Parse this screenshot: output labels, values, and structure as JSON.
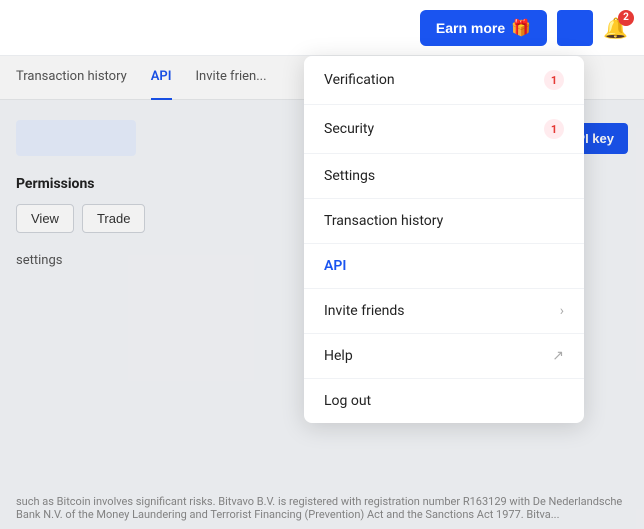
{
  "header": {
    "earn_more_label": "Earn more",
    "earn_more_icon": "🎁",
    "bell_badge": "2"
  },
  "tabs": [
    {
      "label": "Transaction history",
      "active": false
    },
    {
      "label": "API",
      "active": true
    },
    {
      "label": "Invite frien...",
      "active": false
    }
  ],
  "main": {
    "add_api_label": "+ API key",
    "permissions_label": "Permissions",
    "perm_view": "View",
    "perm_trade": "Trade",
    "settings_label": "settings"
  },
  "footer_text": "such as Bitcoin involves significant risks. Bitvavo B.V. is registered with registration number R163129 with De Nederlandsche Bank N.V. of the Money Laundering and Terrorist Financing (Prevention) Act and the Sanctions Act 1977. Bitva...",
  "dropdown": {
    "items": [
      {
        "label": "Verification",
        "badge": "1",
        "has_badge": true,
        "has_chevron": false,
        "has_external": false,
        "active": false
      },
      {
        "label": "Security",
        "badge": "1",
        "has_badge": true,
        "has_chevron": false,
        "has_external": false,
        "active": false
      },
      {
        "label": "Settings",
        "badge": null,
        "has_badge": false,
        "has_chevron": false,
        "has_external": false,
        "active": false
      },
      {
        "label": "Transaction history",
        "badge": null,
        "has_badge": false,
        "has_chevron": false,
        "has_external": false,
        "active": false
      },
      {
        "label": "API",
        "badge": null,
        "has_badge": false,
        "has_chevron": false,
        "has_external": false,
        "active": true
      },
      {
        "label": "Invite friends",
        "badge": null,
        "has_badge": false,
        "has_chevron": true,
        "has_external": false,
        "active": false
      },
      {
        "label": "Help",
        "badge": null,
        "has_badge": false,
        "has_chevron": false,
        "has_external": true,
        "active": false
      },
      {
        "label": "Log out",
        "badge": null,
        "has_badge": false,
        "has_chevron": false,
        "has_external": false,
        "active": false
      }
    ]
  }
}
